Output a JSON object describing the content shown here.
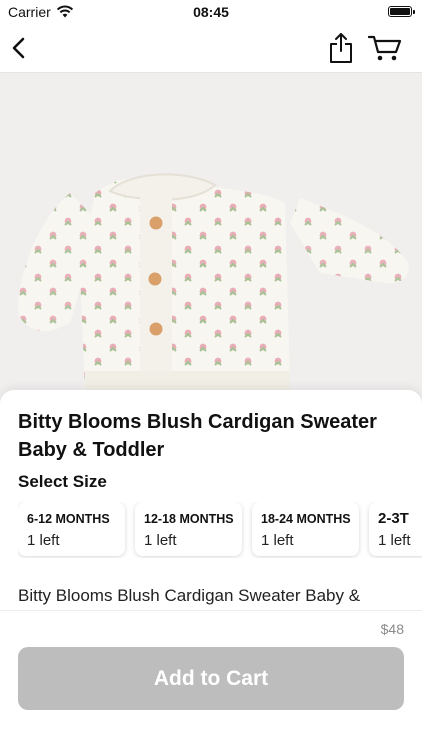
{
  "status_bar": {
    "carrier": "Carrier",
    "time": "08:45"
  },
  "nav": {
    "back_icon": "chevron-left-icon",
    "share_icon": "share-icon",
    "cart_icon": "cart-icon"
  },
  "product": {
    "image": "cardigan-photo",
    "title": "Bitty Blooms Blush Cardigan Sweater Baby & Toddler",
    "select_size_label": "Select Size",
    "sizes": [
      {
        "name": "6-12 MONTHS",
        "stock": "1 left"
      },
      {
        "name": "12-18 MONTHS",
        "stock": "1 left"
      },
      {
        "name": "18-24 MONTHS",
        "stock": "1 left"
      },
      {
        "name": "2-3T",
        "stock": "1 left"
      }
    ],
    "description": "Bitty Blooms Blush Cardigan Sweater Baby &",
    "price": "$48"
  },
  "actions": {
    "add_to_cart_label": "Add to Cart"
  }
}
